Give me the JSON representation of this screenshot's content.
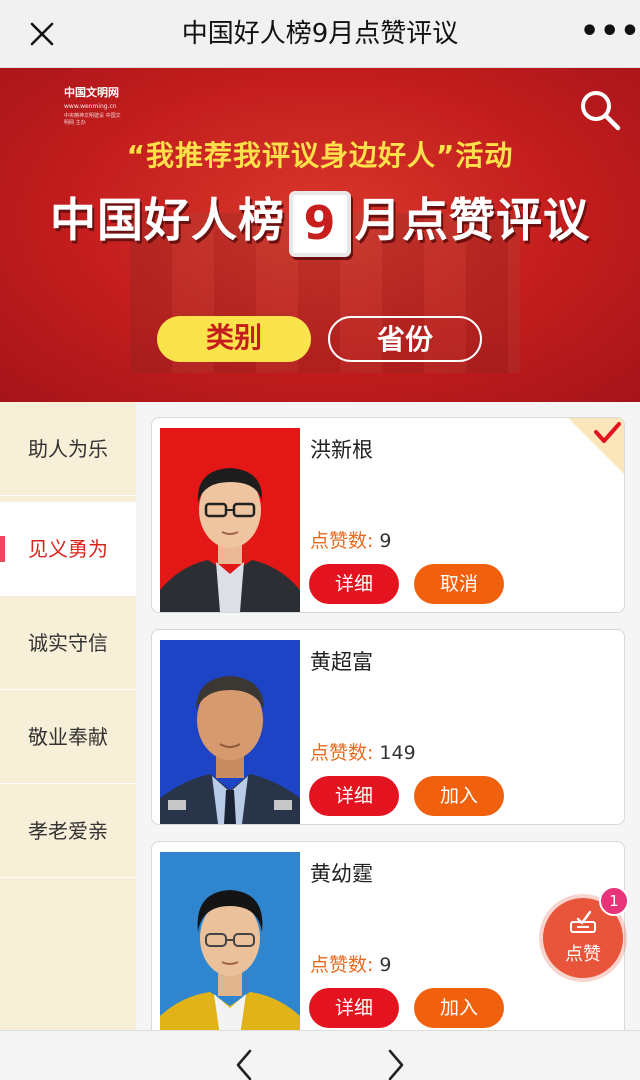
{
  "topbar": {
    "title": "中国好人榜9月点赞评议",
    "more": "•••"
  },
  "banner": {
    "logo_main": "中国文明网",
    "logo_url": "www.wenming.cn",
    "logo_sub": "中央精神文明建设 中国文明网 主办",
    "slogan": "“我推荐我评议身边好人”活动",
    "headline_pre": "中国好人榜",
    "headline_num": "9",
    "headline_post": "月点赞评议",
    "pill_category": "类别",
    "pill_province": "省份"
  },
  "sidebar": {
    "items": [
      {
        "label": "助人为乐"
      },
      {
        "label": "见义勇为"
      },
      {
        "label": "诚实守信"
      },
      {
        "label": "敬业奉献"
      },
      {
        "label": "孝老爱亲"
      }
    ],
    "active_index": 1
  },
  "cards": [
    {
      "name": "洪新根",
      "likes_label": "点赞数:",
      "likes": "9",
      "detail": "详细",
      "action": "取消",
      "selected": true
    },
    {
      "name": "黄超富",
      "likes_label": "点赞数:",
      "likes": "149",
      "detail": "详细",
      "action": "加入",
      "selected": false
    },
    {
      "name": "黄幼霆",
      "likes_label": "点赞数:",
      "likes": "9",
      "detail": "详细",
      "action": "加入",
      "selected": false
    }
  ],
  "fab": {
    "label": "点赞",
    "badge": "1"
  },
  "colors": {
    "accent_red": "#e3141f",
    "accent_orange": "#f0600d",
    "banner_red": "#c31d1d",
    "sidebar_bg": "#f8efd8"
  }
}
